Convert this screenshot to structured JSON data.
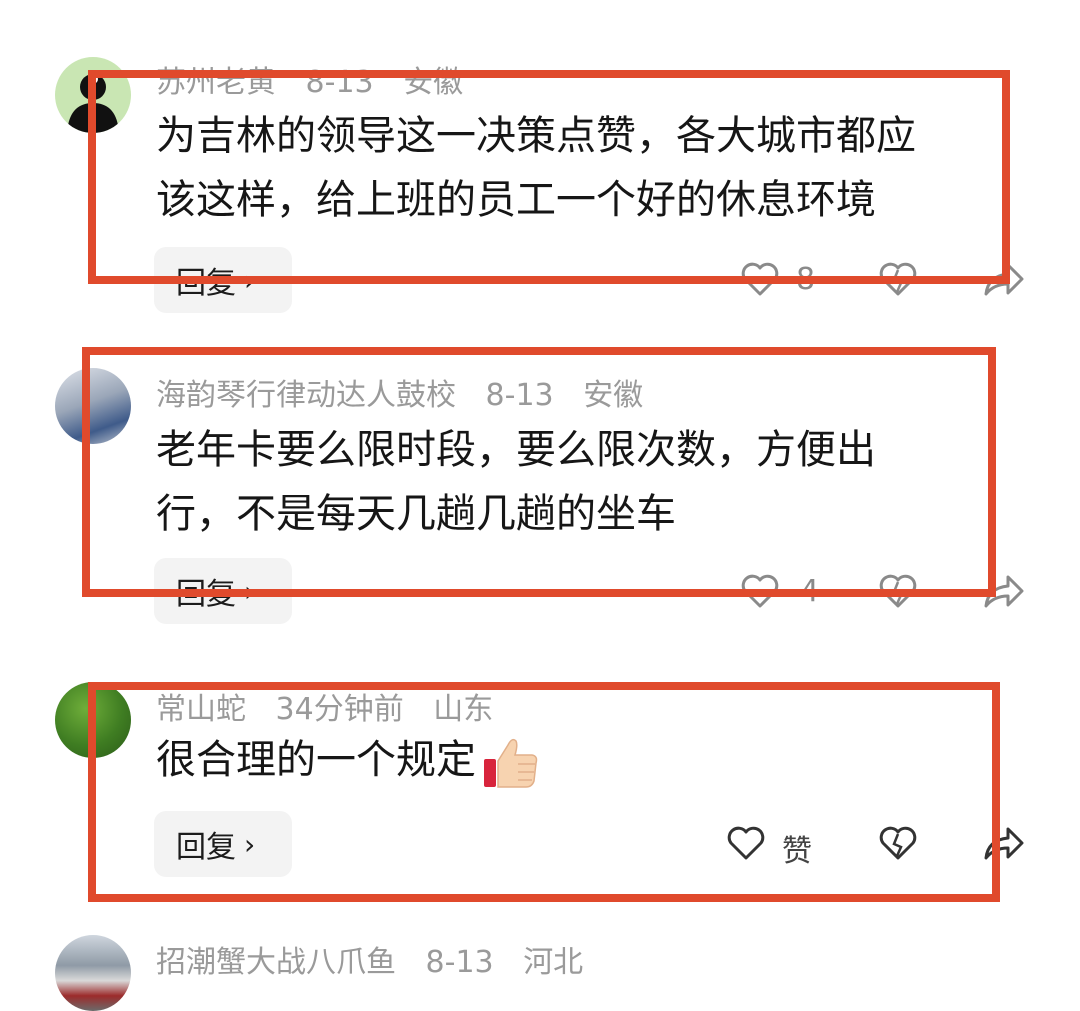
{
  "comments": [
    {
      "username": "苏州老黄",
      "time": "8-13",
      "location": "安徽",
      "text_line1": "为吉林的领导这一决策点赞，各大城市都应",
      "text_line2": "该这样，给上班的员工一个好的休息环境",
      "reply_label": "回复",
      "like_count": "8"
    },
    {
      "username": "海韵琴行律动达人鼓校",
      "time": "8-13",
      "location": "安徽",
      "text_line1": "老年卡要么限时段，要么限次数，方便出",
      "text_line2": "行，不是每天几趟几趟的坐车",
      "reply_label": "回复",
      "like_count": "4"
    },
    {
      "username": "常山蛇",
      "time": "34分钟前",
      "location": "山东",
      "text_line1": "很合理的一个规定",
      "emoji": "thumbs-up",
      "reply_label": "回复",
      "like_count": "赞"
    },
    {
      "username": "招潮蟹大战八爪鱼",
      "time": "8-13",
      "location": "河北"
    }
  ],
  "colors": {
    "highlight_box": "#e04a2c",
    "meta_text": "#9a9a9a",
    "body_text": "#161616",
    "reply_bg": "#f3f3f3"
  }
}
